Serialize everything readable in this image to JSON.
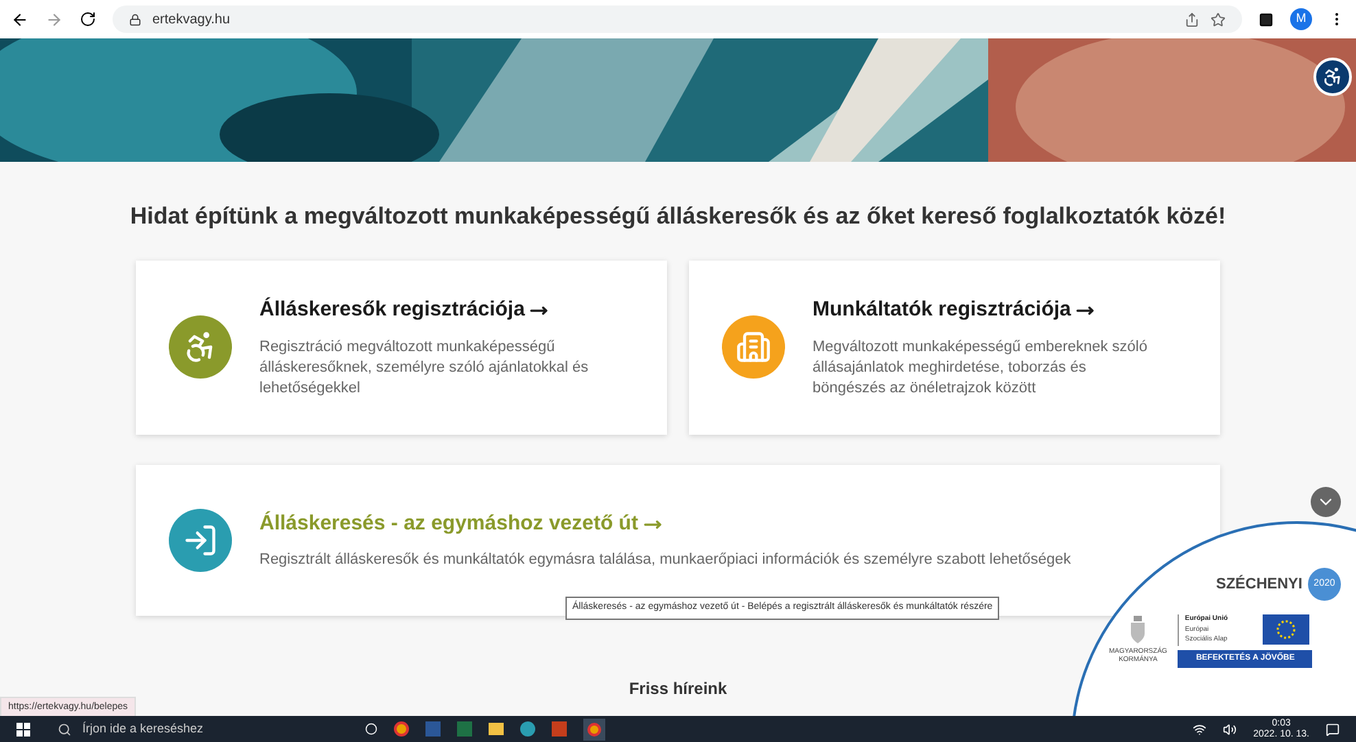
{
  "browser": {
    "url": "ertekvagy.hu",
    "profile": "M"
  },
  "headline": "Hidat építünk a megváltozott munkaképességű álláskeresők és az őket kereső foglalkoztatók közé!",
  "cards": [
    {
      "kind": "seeker",
      "title": "Álláskeresők regisztrációja",
      "text": "Regisztráció megváltozott munkaképességű álláskeresőknek, személyre szóló ajánlatokkal és lehetőségekkel",
      "color": "#8a9a2b"
    },
    {
      "kind": "employer",
      "title": "Munkáltatók regisztrációja",
      "text": "Megváltozott munkaképességű embereknek szóló állásajánlatok meghirdetése, toborzás és böngészés az önéletrajzok között",
      "color": "#f5a21c"
    }
  ],
  "wide_card": {
    "kind": "login",
    "title": "Álláskeresés - az egymáshoz vezető út",
    "text": "Regisztrált álláskeresők és munkáltatók egymásra találása, munkaerőpiaci információk és személyre szabott lehetőségek",
    "color": "#2a9db0"
  },
  "tooltip": "Álláskeresés - az egymáshoz vezető út - Belépés a regisztrált álláskeresők és munkáltatók részére",
  "news_heading": "Friss híreink",
  "status_url": "https://ertekvagy.hu/belepes",
  "badge": {
    "brand": "SZÉCHENYI",
    "year": "2020",
    "gov_line1": "MAGYARORSZÁG",
    "gov_line2": "KORMÁNYA",
    "eu_title": "Európai Unió",
    "eu_fund": "Európai Szociális Alap",
    "slogan": "BEFEKTETÉS A JÖVŐBE"
  },
  "taskbar": {
    "search_placeholder": "Írjon ide a kereséshez",
    "time": "0:03",
    "date": "2022. 10. 13."
  }
}
